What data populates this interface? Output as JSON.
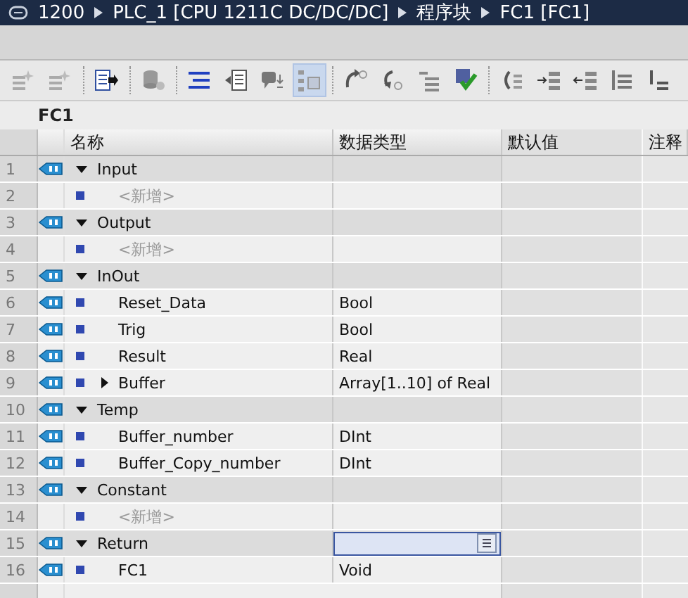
{
  "breadcrumb": [
    {
      "text": "1200"
    },
    {
      "text": "PLC_1 [CPU 1211C DC/DC/DC]"
    },
    {
      "text": "程序块"
    },
    {
      "text": "FC1 [FC1]"
    }
  ],
  "toolbar": [
    {
      "selected": false
    },
    {
      "selected": false
    },
    {
      "selected": false
    },
    {
      "selected": false
    },
    {
      "selected": false
    },
    {
      "selected": false
    },
    {
      "selected": false
    },
    {
      "selected": true
    },
    {
      "selected": false
    },
    {
      "selected": false
    },
    {
      "selected": false
    },
    {
      "selected": false
    },
    {
      "selected": false
    },
    {
      "selected": false
    },
    {
      "selected": false
    },
    {
      "selected": false
    },
    {
      "selected": false
    }
  ],
  "block_title": "FC1",
  "columns": [
    "名称",
    "数据类型",
    "默认值",
    "注释"
  ],
  "rows": [
    {
      "number": "1",
      "kind": "section",
      "name": "Input",
      "expanded": true,
      "selected": false
    },
    {
      "number": "2",
      "kind": "add",
      "name": "<新增>",
      "selected": false
    },
    {
      "number": "3",
      "kind": "section",
      "name": "Output",
      "expanded": true,
      "selected": false
    },
    {
      "number": "4",
      "kind": "add",
      "name": "<新增>",
      "selected": false
    },
    {
      "number": "5",
      "kind": "section",
      "name": "InOut",
      "expanded": true,
      "selected": false
    },
    {
      "number": "6",
      "kind": "member",
      "name": "Reset_Data",
      "data_type": "Bool",
      "selected": false
    },
    {
      "number": "7",
      "kind": "member",
      "name": "Trig",
      "data_type": "Bool",
      "selected": false
    },
    {
      "number": "8",
      "kind": "member",
      "name": "Result",
      "data_type": "Real",
      "selected": false
    },
    {
      "number": "9",
      "kind": "member",
      "name": "Buffer",
      "data_type": "Array[1..10] of Real",
      "expanded": false,
      "selected": false
    },
    {
      "number": "10",
      "kind": "section",
      "name": "Temp",
      "expanded": true,
      "selected": false
    },
    {
      "number": "11",
      "kind": "member",
      "name": "Buffer_number",
      "data_type": "DInt",
      "selected": false
    },
    {
      "number": "12",
      "kind": "member",
      "name": "Buffer_Copy_number",
      "data_type": "DInt",
      "selected": false
    },
    {
      "number": "13",
      "kind": "section",
      "name": "Constant",
      "expanded": true,
      "selected": false
    },
    {
      "number": "14",
      "kind": "add",
      "name": "<新增>",
      "selected": false
    },
    {
      "number": "15",
      "kind": "section",
      "name": "Return",
      "expanded": true,
      "selected": true
    },
    {
      "number": "16",
      "kind": "member",
      "name": "FC1",
      "data_type": "Void",
      "selected": false
    }
  ]
}
